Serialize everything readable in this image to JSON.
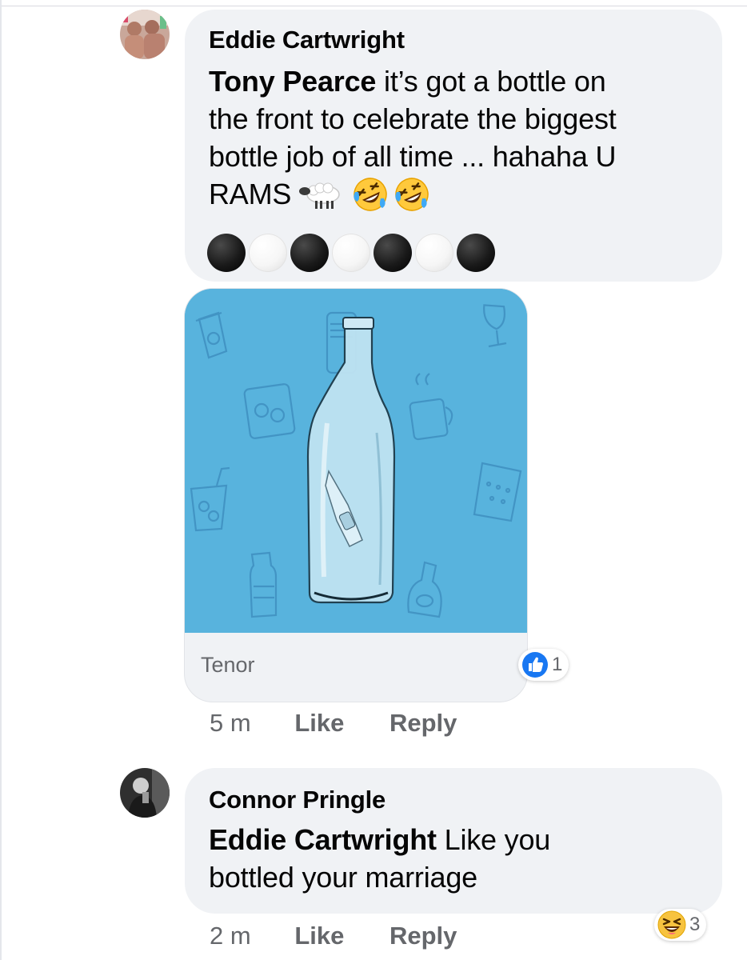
{
  "comments": [
    {
      "author": "Eddie Cartwright",
      "mention": "Tony Pearce",
      "lines": [
        "it’s got a bottle on",
        "the front to celebrate the biggest",
        "bottle job of all time ... hahaha U",
        "RAMS"
      ],
      "emoji_icons": [
        "sheep-icon",
        "rolling-laughing-icon",
        "rolling-laughing-icon"
      ],
      "dots": [
        "black",
        "white",
        "black",
        "white",
        "black",
        "white",
        "black"
      ],
      "attachment": {
        "type": "gif",
        "source": "Tenor"
      },
      "reaction": {
        "icon": "like-icon",
        "count": "1",
        "color": "#1877f2"
      },
      "time": "5 m",
      "like_label": "Like",
      "reply_label": "Reply"
    },
    {
      "author": "Connor Pringle",
      "mention": "Eddie Cartwright",
      "lines": [
        "Like you",
        "bottled your marriage"
      ],
      "reaction": {
        "icon": "haha-icon",
        "count": "3"
      },
      "time": "2 m",
      "like_label": "Like",
      "reply_label": "Reply"
    }
  ]
}
